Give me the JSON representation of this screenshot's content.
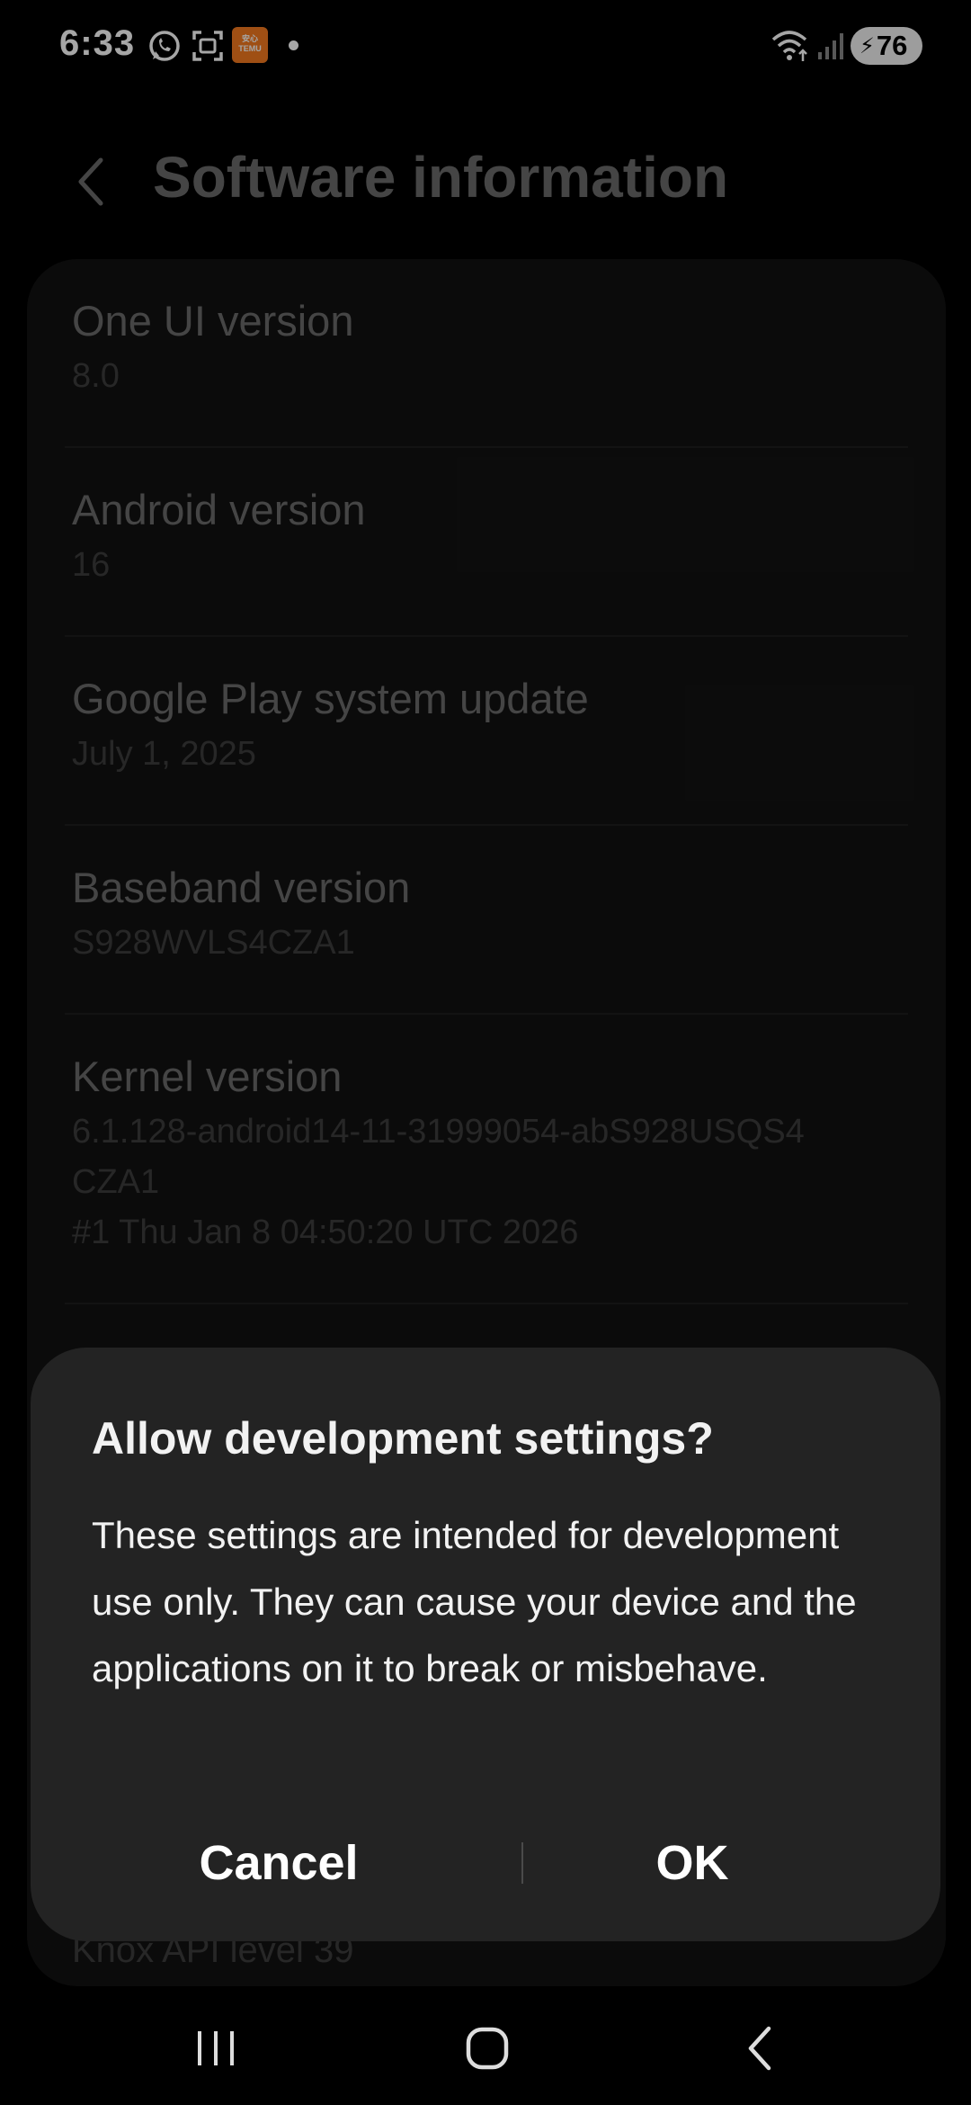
{
  "status_bar": {
    "time": "6:33",
    "battery": "76",
    "icons": [
      "whatsapp-icon",
      "screenshot-icon",
      "temu-icon",
      "dot-icon",
      "wifi-icon",
      "signal-icon",
      "battery-icon"
    ],
    "temu_label_top": "安心",
    "temu_label_bottom": "TEMU"
  },
  "header": {
    "title": "Software information",
    "back_icon": "chevron-left-icon"
  },
  "items": [
    {
      "title": "One UI version",
      "value": "8.0"
    },
    {
      "title": "Android version",
      "value": "16"
    },
    {
      "title": "Google Play system update",
      "value": "July 1, 2025"
    },
    {
      "title": "Baseband version",
      "value": "S928WVLS4CZA1"
    },
    {
      "title": "Kernel version",
      "value_lines": [
        "6.1.128-android14-11-31999054-abS928USQS4",
        "CZA1",
        "#1 Thu Jan  8 04:50:20 UTC 2026"
      ]
    }
  ],
  "partial_item": "Knox API level 39",
  "dialog": {
    "title": "Allow development settings?",
    "message": "These settings are intended for development use only. They can cause your device and the applications on it to break or misbehave.",
    "cancel_label": "Cancel",
    "ok_label": "OK"
  },
  "nav_bar": {
    "icons": [
      "recents-icon",
      "home-icon",
      "back-icon"
    ]
  }
}
